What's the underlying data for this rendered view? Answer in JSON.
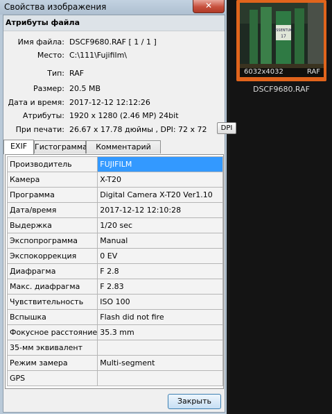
{
  "window": {
    "title": "Свойства изображения",
    "close_icon": "close-icon"
  },
  "attributes": {
    "section_title": "Атрибуты файла",
    "rows": [
      {
        "label": "Имя файла:",
        "value": "DSCF9680.RAF   [ 1 / 1 ]"
      },
      {
        "label": "Место:",
        "value": "C:\\111\\Fujifilm\\"
      },
      {
        "label": "Тип:",
        "value": "RAF"
      },
      {
        "label": "Размер:",
        "value": "20.5 MB"
      },
      {
        "label": "Дата и время:",
        "value": "2017-12-12 12:12:26"
      },
      {
        "label": "Атрибуты:",
        "value": "1920 x 1280 (2.46 MP)  24bit"
      },
      {
        "label": "При печати:",
        "value": "26.67 x 17.78 дюймы ,  DPI: 72 x 72"
      }
    ],
    "dpi_button": "DPI"
  },
  "tabs": [
    {
      "label": "EXIF",
      "active": true
    },
    {
      "label": "Гистограмма",
      "active": false
    },
    {
      "label": "Комментарий JPEG",
      "active": false
    }
  ],
  "exif": [
    {
      "key": "Производитель",
      "value": "FUJIFILM"
    },
    {
      "key": "Камера",
      "value": "X-T20"
    },
    {
      "key": "Программа",
      "value": "Digital Camera X-T20 Ver1.10"
    },
    {
      "key": "Дата/время",
      "value": "2017-12-12 12:10:28"
    },
    {
      "key": "Выдержка",
      "value": "1/20 sec"
    },
    {
      "key": "Экспопрограмма",
      "value": "Manual"
    },
    {
      "key": "Экспокоррекция",
      "value": "0 EV"
    },
    {
      "key": "Диафрагма",
      "value": "F 2.8"
    },
    {
      "key": "Макс. диафрагма",
      "value": "F 2.83"
    },
    {
      "key": "Чувствительность",
      "value": "ISO 100"
    },
    {
      "key": "Вспышка",
      "value": "Flash did not fire"
    },
    {
      "key": "Фокусное расстояние",
      "value": "35.3 mm"
    },
    {
      "key": "35-мм эквивалент",
      "value": ""
    },
    {
      "key": "Режим замера",
      "value": "Multi-segment"
    },
    {
      "key": "GPS",
      "value": ""
    }
  ],
  "ok_button": "Закрыть",
  "thumbnail": {
    "dimensions": "6032x4032",
    "format": "RAF",
    "filename": "DSCF9680.RAF",
    "bottle_label": "ESSENTUKI",
    "bottle_number": "17",
    "accent_color": "#e0641c"
  }
}
